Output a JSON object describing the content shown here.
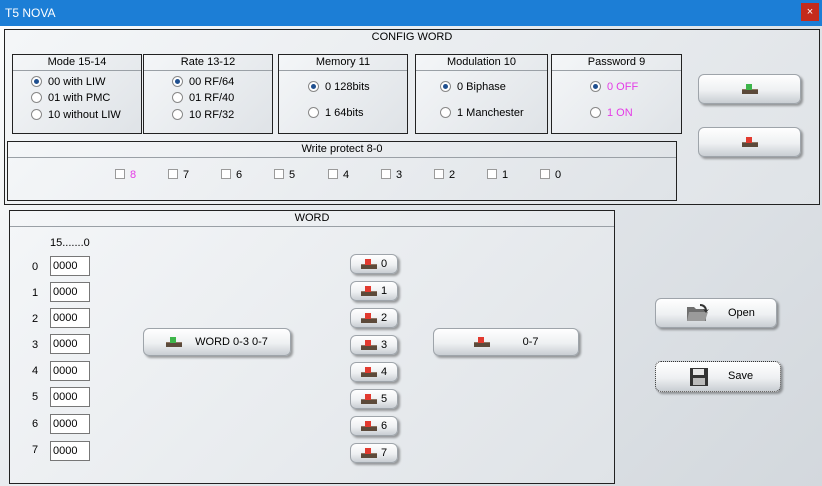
{
  "window": {
    "title": "T5 NOVA",
    "close_glyph": "×"
  },
  "config_word": {
    "title": "CONFIG WORD",
    "mode": {
      "title": "Mode 15-14",
      "options": [
        "00 with LIW",
        "01 with PMC",
        "10 without LIW"
      ],
      "selected": 0
    },
    "rate": {
      "title": "Rate 13-12",
      "options": [
        "00 RF/64",
        "01 RF/40",
        "10 RF/32"
      ],
      "selected": 0
    },
    "memory": {
      "title": "Memory 11",
      "options": [
        "0 128bits",
        "1 64bits"
      ],
      "selected": 0
    },
    "modulation": {
      "title": "Modulation 10",
      "options": [
        "0 Biphase",
        "1 Manchester"
      ],
      "selected": 0
    },
    "password": {
      "title": "Password 9",
      "options": [
        "0 OFF",
        "1 ON"
      ],
      "selected": 0
    },
    "write_protect": {
      "title": "Write protect 8-0",
      "bits": [
        "8",
        "7",
        "6",
        "5",
        "4",
        "3",
        "2",
        "1",
        "0"
      ]
    }
  },
  "word": {
    "title": "WORD",
    "bit_header": "15.......0",
    "rows": [
      {
        "index": "0",
        "value": "0000"
      },
      {
        "index": "1",
        "value": "0000"
      },
      {
        "index": "2",
        "value": "0000"
      },
      {
        "index": "3",
        "value": "0000"
      },
      {
        "index": "4",
        "value": "0000"
      },
      {
        "index": "5",
        "value": "0000"
      },
      {
        "index": "6",
        "value": "0000"
      },
      {
        "index": "7",
        "value": "0000"
      }
    ],
    "read_all_label": "WORD 0-3 0-7",
    "write_all_label": "0-7",
    "row_buttons": [
      "0",
      "1",
      "2",
      "3",
      "4",
      "5",
      "6",
      "7"
    ]
  },
  "actions": {
    "open_label": "Open",
    "save_label": "Save"
  },
  "icons": {
    "read": "tray-arrow-up-icon",
    "write": "tray-arrow-down-icon",
    "open": "open-folder-icon",
    "save": "floppy-disk-icon"
  },
  "colors": {
    "titlebar": "#1c7ed6",
    "close": "#c42b1c",
    "accent_pink": "#e43be6",
    "read_arrow": "#3db54a",
    "write_arrow": "#e23a2f"
  }
}
